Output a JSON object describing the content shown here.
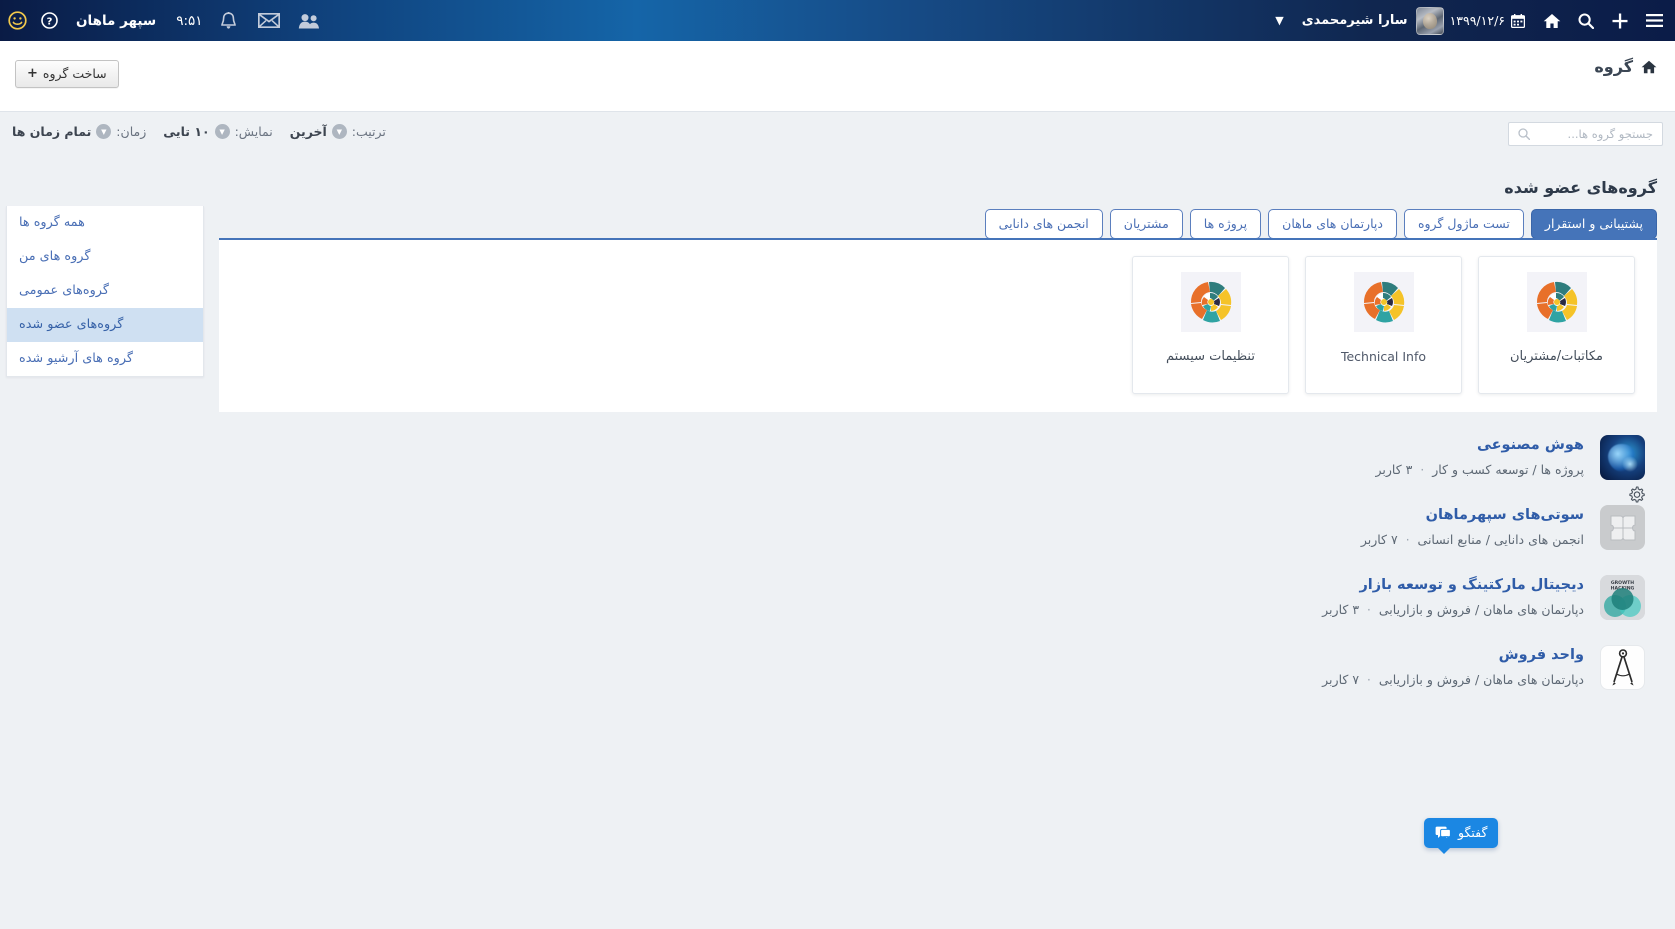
{
  "topbar": {
    "smiley_icon": "smiley-icon",
    "help_icon": "help-icon",
    "org_name": "سپهر ماهان",
    "time": "۹:۵۱",
    "bell_icon": "bell-icon",
    "mail_icon": "mail-icon",
    "contacts_icon": "contacts-icon",
    "caret_icon": "chevron-down-icon",
    "user_name": "سارا شیرمحمدی",
    "avatar": "user-avatar",
    "date": "۱۳۹۹/۱۲/۶",
    "calendar_icon": "calendar-icon",
    "home_icon": "home-icon",
    "search_icon": "search-icon",
    "plus_icon": "plus-icon",
    "menu_icon": "hamburger-menu-icon"
  },
  "actionbar": {
    "breadcrumb": "گروه",
    "home_icon": "home-icon",
    "create_button": "ساخت گروه",
    "create_plus": "+"
  },
  "filters": [
    {
      "label": "ترتیب:",
      "value": "آخرین"
    },
    {
      "label": "نمایش:",
      "value": "۱۰ تایی"
    },
    {
      "label": "زمان:",
      "value": "تمام زمان ها"
    }
  ],
  "search": {
    "placeholder": "جستجو گروه ها...",
    "value": "",
    "icon": "search-icon"
  },
  "section": {
    "title": "گروه‌های عضو شده"
  },
  "tabs": [
    {
      "label": "پشتیبانی و استقرار",
      "active": true
    },
    {
      "label": "تست ماژول گروه",
      "active": false
    },
    {
      "label": "دپارتمان های ماهان",
      "active": false
    },
    {
      "label": "پروژه ها",
      "active": false
    },
    {
      "label": "مشتریان",
      "active": false
    },
    {
      "label": "انجمن های دانایی",
      "active": false
    }
  ],
  "sidebar": {
    "items": [
      {
        "label": "همه گروه ها",
        "active": false
      },
      {
        "label": "گروه های من",
        "active": false
      },
      {
        "label": "گروه‌های عمومی",
        "active": false
      },
      {
        "label": "گروه‌های عضو شده",
        "active": true
      },
      {
        "label": "گروه های آرشیو شده",
        "active": false
      }
    ]
  },
  "cards": [
    {
      "label": "مکاتبات/مشتریان",
      "icon": "pinwheel-logo-icon",
      "latin": false
    },
    {
      "label": "Technical Info",
      "icon": "pinwheel-logo-icon",
      "latin": true
    },
    {
      "label": "تنظیمات سیستم",
      "icon": "pinwheel-logo-icon",
      "latin": false
    }
  ],
  "groups": [
    {
      "title": "هوش مصنوعی",
      "path": "پروژه ها / توسعه کسب و کار",
      "members": "۳ کاربر",
      "separator": "·",
      "thumb": "ai-brain-thumbnail",
      "has_gear": true,
      "gear_icon": "gear-icon"
    },
    {
      "title": "سوتی‌های سپهرماهان",
      "path": "انجمن های دانایی / منابع انسانی",
      "members": "۷ کاربر",
      "separator": "·",
      "thumb": "puzzle-piece-thumbnail",
      "has_gear": false,
      "gear_icon": ""
    },
    {
      "title": "دیجیتال مارکتینگ و توسعه بازار",
      "path": "دپارتمان های ماهان / فروش و بازاریابی",
      "members": "۳ کاربر",
      "separator": "·",
      "thumb": "growth-hacking-thumbnail",
      "has_gear": false,
      "gear_icon": ""
    },
    {
      "title": "واحد فروش",
      "path": "دپارتمان های ماهان / فروش و بازاریابی",
      "members": "۷ کاربر",
      "separator": "·",
      "thumb": "compass-thumbnail",
      "has_gear": false,
      "gear_icon": ""
    }
  ],
  "chat": {
    "label": "گفتگو",
    "icon": "chat-bubble-icon"
  },
  "colors": {
    "accent_blue": "#4574b9",
    "link_blue": "#2f5ca8",
    "topbar_dark": "#0b1c48",
    "topbar_bright": "#1565a8",
    "page_bg": "#eef1f4",
    "sidebar_active": "#cfe0f2",
    "chat_blue": "#1b87e3"
  }
}
